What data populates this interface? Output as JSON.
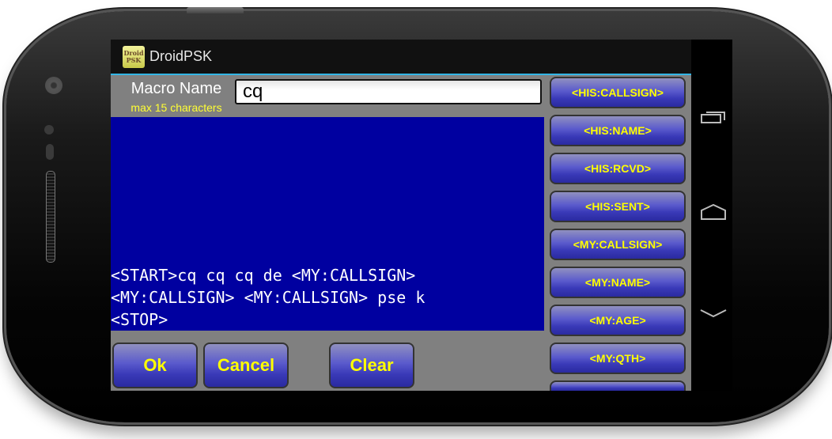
{
  "app": {
    "title": "DroidPSK",
    "icon_text_line1": "Droid",
    "icon_text_line2": "PSK"
  },
  "macro_name": {
    "label": "Macro Name",
    "hint": "max 15 characters",
    "value": "cq"
  },
  "macro_text": {
    "lines": [
      "<START>cq cq cq de <MY:CALLSIGN>",
      "<MY:CALLSIGN> <MY:CALLSIGN> pse k",
      "<STOP>"
    ]
  },
  "buttons": {
    "ok": "Ok",
    "cancel": "Cancel",
    "clear": "Clear"
  },
  "tag_buttons": [
    "<HIS:CALLSIGN>",
    "<HIS:NAME>",
    "<HIS:RCVD>",
    "<HIS:SENT>",
    "<MY:CALLSIGN>",
    "<MY:NAME>",
    "<MY:AGE>",
    "<MY:QTH>",
    ""
  ],
  "navbar": {
    "icons": [
      "recent-apps-icon",
      "home-icon",
      "back-icon"
    ]
  },
  "colors": {
    "accent": "#33b5e5",
    "button_text": "#ffff00",
    "editor_bg": "#0000a0",
    "panel_bg": "#808080"
  }
}
